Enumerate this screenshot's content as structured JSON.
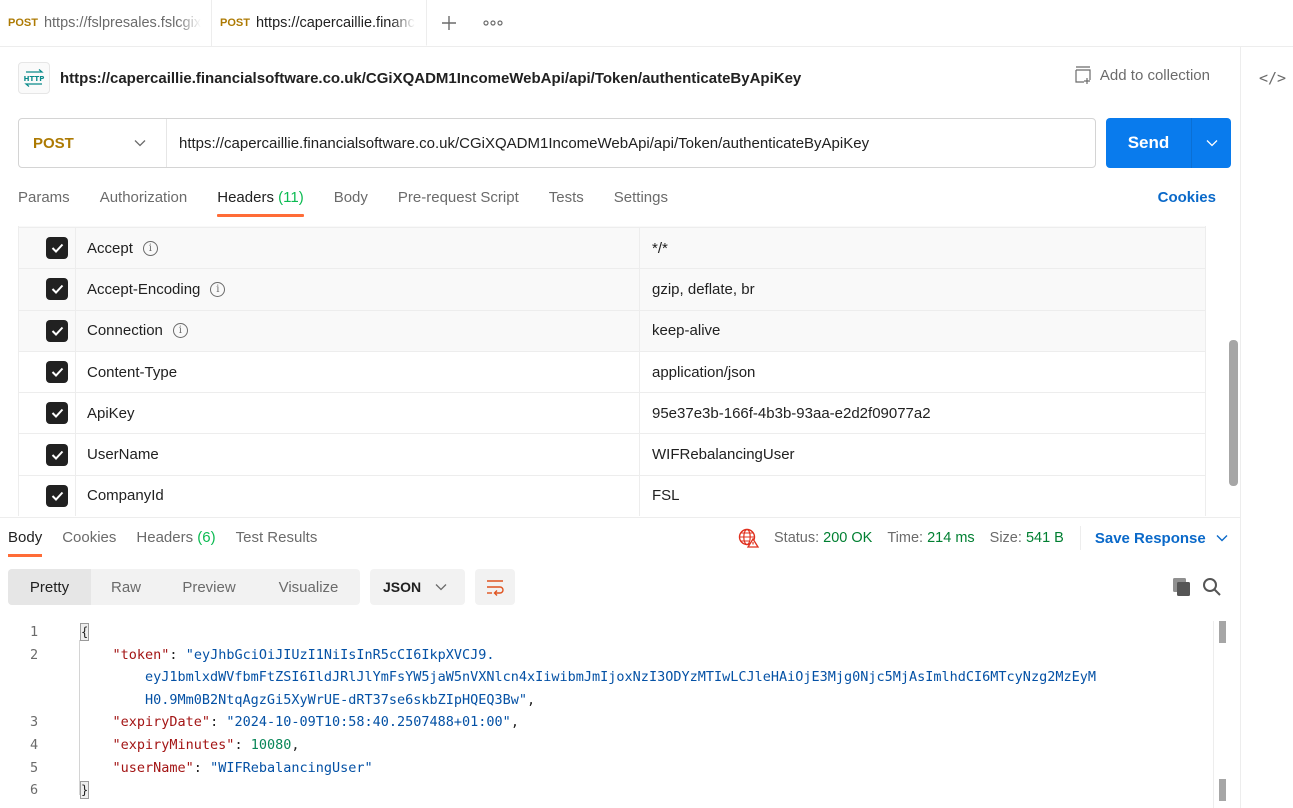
{
  "tabs": [
    {
      "method": "POST",
      "url": "https://fslpresales.fslcgix",
      "active": false
    },
    {
      "method": "POST",
      "url": "https://capercaillie.financ",
      "active": true
    }
  ],
  "tab_actions": {
    "new_tab_icon": "plus-icon",
    "more_icon": "ellipsis-icon"
  },
  "request": {
    "title": "https://capercaillie.financialsoftware.co.uk/CGiXQADM1IncomeWebApi/api/Token/authenticateByApiKey",
    "add_to_collection": "Add to collection",
    "method": "POST",
    "url": "https://capercaillie.financialsoftware.co.uk/CGiXQADM1IncomeWebApi/api/Token/authenticateByApiKey",
    "send_label": "Send",
    "tabs": [
      {
        "label": "Params"
      },
      {
        "label": "Authorization"
      },
      {
        "label": "Headers",
        "count": "(11)",
        "active": true
      },
      {
        "label": "Body"
      },
      {
        "label": "Pre-request Script"
      },
      {
        "label": "Tests"
      },
      {
        "label": "Settings"
      }
    ],
    "cookies_label": "Cookies",
    "headers": [
      {
        "key": "Accept",
        "value": "*/*",
        "info": true,
        "checked": true,
        "auto": true
      },
      {
        "key": "Accept-Encoding",
        "value": "gzip, deflate, br",
        "info": true,
        "checked": true,
        "auto": true
      },
      {
        "key": "Connection",
        "value": "keep-alive",
        "info": true,
        "checked": true,
        "auto": true
      },
      {
        "key": "Content-Type",
        "value": "application/json",
        "info": false,
        "checked": true,
        "auto": false
      },
      {
        "key": "ApiKey",
        "value": "95e37e3b-166f-4b3b-93aa-e2d2f09077a2",
        "info": false,
        "checked": true,
        "auto": false
      },
      {
        "key": "UserName",
        "value": "WIFRebalancingUser",
        "info": false,
        "checked": true,
        "auto": false
      },
      {
        "key": "CompanyId",
        "value": "FSL",
        "info": false,
        "checked": true,
        "auto": false
      }
    ]
  },
  "response": {
    "tabs": [
      {
        "label": "Body",
        "active": true
      },
      {
        "label": "Cookies"
      },
      {
        "label": "Headers",
        "count": "(6)"
      },
      {
        "label": "Test Results"
      }
    ],
    "status_label": "Status:",
    "status_value": "200 OK",
    "time_label": "Time:",
    "time_value": "214 ms",
    "size_label": "Size:",
    "size_value": "541 B",
    "save_response": "Save Response",
    "views": [
      "Pretty",
      "Raw",
      "Preview",
      "Visualize"
    ],
    "active_view": "Pretty",
    "format": "JSON",
    "body_lines": [
      {
        "n": "1",
        "parts": [
          {
            "t": "{",
            "c": "brace"
          }
        ]
      },
      {
        "n": "2",
        "parts": [
          {
            "t": "    ",
            "c": ""
          },
          {
            "t": "\"token\"",
            "c": "k"
          },
          {
            "t": ": ",
            "c": ""
          },
          {
            "t": "\"eyJhbGciOiJIUzI1NiIsInR5cCI6IkpXVCJ9.",
            "c": "s"
          }
        ]
      },
      {
        "n": "",
        "parts": [
          {
            "t": "        eyJ1bmlxdWVfbmFtZSI6IldJRlJlYmFsYW5jaW5nVXNlcn4xIiwibmJmIjoxNzI3ODYzMTIwLCJleHAiOjE3Mjg0Njc5MjAsImlhdCI6MTcyNzg2MzEyM",
            "c": "s"
          }
        ]
      },
      {
        "n": "",
        "parts": [
          {
            "t": "        H0.9Mm0B2NtqAgzGi5XyWrUE-dRT37se6skbZIpHQEQ3Bw\"",
            "c": "s"
          },
          {
            "t": ",",
            "c": ""
          }
        ]
      },
      {
        "n": "3",
        "parts": [
          {
            "t": "    ",
            "c": ""
          },
          {
            "t": "\"expiryDate\"",
            "c": "k"
          },
          {
            "t": ": ",
            "c": ""
          },
          {
            "t": "\"2024-10-09T10:58:40.2507488+01:00\"",
            "c": "s"
          },
          {
            "t": ",",
            "c": ""
          }
        ]
      },
      {
        "n": "4",
        "parts": [
          {
            "t": "    ",
            "c": ""
          },
          {
            "t": "\"expiryMinutes\"",
            "c": "k"
          },
          {
            "t": ": ",
            "c": ""
          },
          {
            "t": "10080",
            "c": "n"
          },
          {
            "t": ",",
            "c": ""
          }
        ]
      },
      {
        "n": "5",
        "parts": [
          {
            "t": "    ",
            "c": ""
          },
          {
            "t": "\"userName\"",
            "c": "k"
          },
          {
            "t": ": ",
            "c": ""
          },
          {
            "t": "\"WIFRebalancingUser\"",
            "c": "s"
          }
        ]
      },
      {
        "n": "6",
        "parts": [
          {
            "t": "}",
            "c": "brace"
          }
        ]
      }
    ]
  },
  "colors": {
    "accent": "#097bed",
    "link": "#0a69c9",
    "method": "#ad7a03",
    "active_tab_underline": "#ff6c37",
    "status_green": "#007f31",
    "count_green": "#0cbb52"
  }
}
